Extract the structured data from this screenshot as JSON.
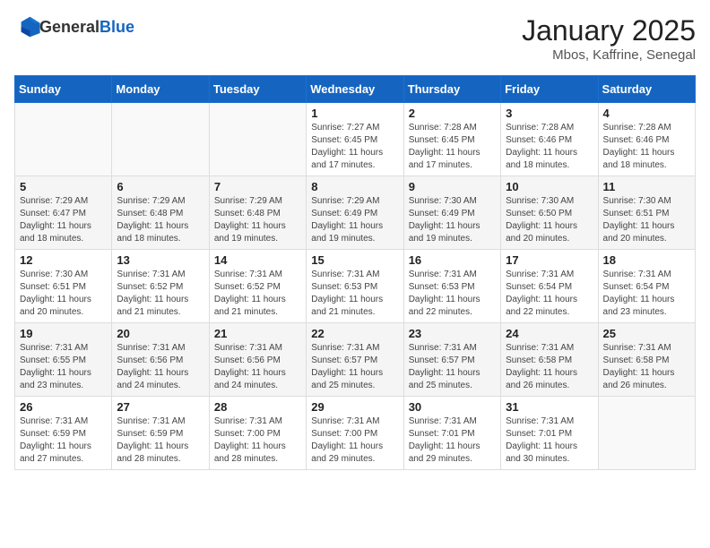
{
  "header": {
    "logo_general": "General",
    "logo_blue": "Blue",
    "month_title": "January 2025",
    "location": "Mbos, Kaffrine, Senegal"
  },
  "days_of_week": [
    "Sunday",
    "Monday",
    "Tuesday",
    "Wednesday",
    "Thursday",
    "Friday",
    "Saturday"
  ],
  "weeks": [
    [
      {
        "day": "",
        "info": ""
      },
      {
        "day": "",
        "info": ""
      },
      {
        "day": "",
        "info": ""
      },
      {
        "day": "1",
        "info": "Sunrise: 7:27 AM\nSunset: 6:45 PM\nDaylight: 11 hours and 17 minutes."
      },
      {
        "day": "2",
        "info": "Sunrise: 7:28 AM\nSunset: 6:45 PM\nDaylight: 11 hours and 17 minutes."
      },
      {
        "day": "3",
        "info": "Sunrise: 7:28 AM\nSunset: 6:46 PM\nDaylight: 11 hours and 18 minutes."
      },
      {
        "day": "4",
        "info": "Sunrise: 7:28 AM\nSunset: 6:46 PM\nDaylight: 11 hours and 18 minutes."
      }
    ],
    [
      {
        "day": "5",
        "info": "Sunrise: 7:29 AM\nSunset: 6:47 PM\nDaylight: 11 hours and 18 minutes."
      },
      {
        "day": "6",
        "info": "Sunrise: 7:29 AM\nSunset: 6:48 PM\nDaylight: 11 hours and 18 minutes."
      },
      {
        "day": "7",
        "info": "Sunrise: 7:29 AM\nSunset: 6:48 PM\nDaylight: 11 hours and 19 minutes."
      },
      {
        "day": "8",
        "info": "Sunrise: 7:29 AM\nSunset: 6:49 PM\nDaylight: 11 hours and 19 minutes."
      },
      {
        "day": "9",
        "info": "Sunrise: 7:30 AM\nSunset: 6:49 PM\nDaylight: 11 hours and 19 minutes."
      },
      {
        "day": "10",
        "info": "Sunrise: 7:30 AM\nSunset: 6:50 PM\nDaylight: 11 hours and 20 minutes."
      },
      {
        "day": "11",
        "info": "Sunrise: 7:30 AM\nSunset: 6:51 PM\nDaylight: 11 hours and 20 minutes."
      }
    ],
    [
      {
        "day": "12",
        "info": "Sunrise: 7:30 AM\nSunset: 6:51 PM\nDaylight: 11 hours and 20 minutes."
      },
      {
        "day": "13",
        "info": "Sunrise: 7:31 AM\nSunset: 6:52 PM\nDaylight: 11 hours and 21 minutes."
      },
      {
        "day": "14",
        "info": "Sunrise: 7:31 AM\nSunset: 6:52 PM\nDaylight: 11 hours and 21 minutes."
      },
      {
        "day": "15",
        "info": "Sunrise: 7:31 AM\nSunset: 6:53 PM\nDaylight: 11 hours and 21 minutes."
      },
      {
        "day": "16",
        "info": "Sunrise: 7:31 AM\nSunset: 6:53 PM\nDaylight: 11 hours and 22 minutes."
      },
      {
        "day": "17",
        "info": "Sunrise: 7:31 AM\nSunset: 6:54 PM\nDaylight: 11 hours and 22 minutes."
      },
      {
        "day": "18",
        "info": "Sunrise: 7:31 AM\nSunset: 6:54 PM\nDaylight: 11 hours and 23 minutes."
      }
    ],
    [
      {
        "day": "19",
        "info": "Sunrise: 7:31 AM\nSunset: 6:55 PM\nDaylight: 11 hours and 23 minutes."
      },
      {
        "day": "20",
        "info": "Sunrise: 7:31 AM\nSunset: 6:56 PM\nDaylight: 11 hours and 24 minutes."
      },
      {
        "day": "21",
        "info": "Sunrise: 7:31 AM\nSunset: 6:56 PM\nDaylight: 11 hours and 24 minutes."
      },
      {
        "day": "22",
        "info": "Sunrise: 7:31 AM\nSunset: 6:57 PM\nDaylight: 11 hours and 25 minutes."
      },
      {
        "day": "23",
        "info": "Sunrise: 7:31 AM\nSunset: 6:57 PM\nDaylight: 11 hours and 25 minutes."
      },
      {
        "day": "24",
        "info": "Sunrise: 7:31 AM\nSunset: 6:58 PM\nDaylight: 11 hours and 26 minutes."
      },
      {
        "day": "25",
        "info": "Sunrise: 7:31 AM\nSunset: 6:58 PM\nDaylight: 11 hours and 26 minutes."
      }
    ],
    [
      {
        "day": "26",
        "info": "Sunrise: 7:31 AM\nSunset: 6:59 PM\nDaylight: 11 hours and 27 minutes."
      },
      {
        "day": "27",
        "info": "Sunrise: 7:31 AM\nSunset: 6:59 PM\nDaylight: 11 hours and 28 minutes."
      },
      {
        "day": "28",
        "info": "Sunrise: 7:31 AM\nSunset: 7:00 PM\nDaylight: 11 hours and 28 minutes."
      },
      {
        "day": "29",
        "info": "Sunrise: 7:31 AM\nSunset: 7:00 PM\nDaylight: 11 hours and 29 minutes."
      },
      {
        "day": "30",
        "info": "Sunrise: 7:31 AM\nSunset: 7:01 PM\nDaylight: 11 hours and 29 minutes."
      },
      {
        "day": "31",
        "info": "Sunrise: 7:31 AM\nSunset: 7:01 PM\nDaylight: 11 hours and 30 minutes."
      },
      {
        "day": "",
        "info": ""
      }
    ]
  ]
}
